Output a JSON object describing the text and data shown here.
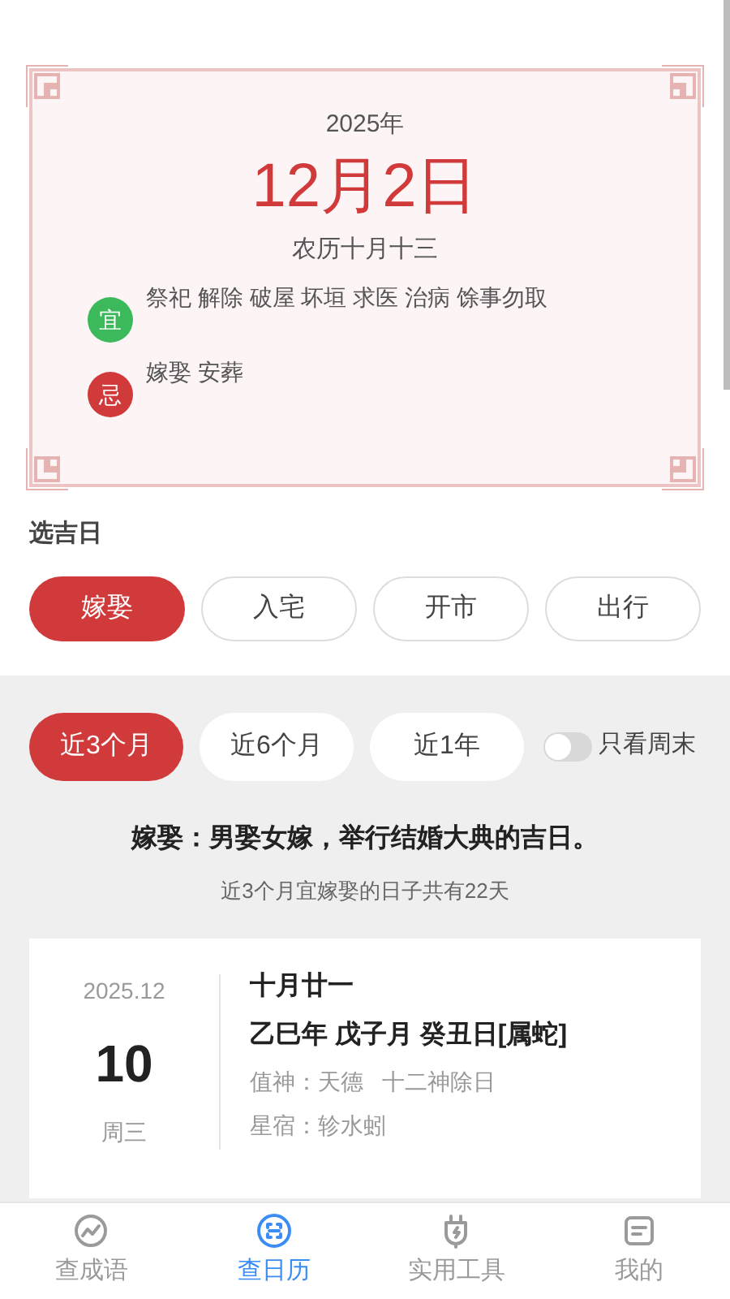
{
  "today": {
    "year": "2025年",
    "date": "12月2日",
    "lunar": "农历十月十三",
    "omens": [
      {
        "kind": "good",
        "badge": "宜",
        "text": "祭祀 解除 破屋 坏垣 求医 治病 馀事勿取"
      },
      {
        "kind": "bad",
        "badge": "忌",
        "text": "嫁娶 安葬"
      }
    ]
  },
  "section_title": "选吉日",
  "categories": [
    {
      "label": "嫁娶",
      "selected": true
    },
    {
      "label": "入宅",
      "selected": false
    },
    {
      "label": "开市",
      "selected": false
    },
    {
      "label": "出行",
      "selected": false
    }
  ],
  "ranges": [
    {
      "label": "近3个月",
      "selected": true
    },
    {
      "label": "近6个月",
      "selected": false
    },
    {
      "label": "近1年",
      "selected": false
    }
  ],
  "weekend_toggle": {
    "label": "只看周末",
    "on": false
  },
  "description": "嫁娶：男娶女嫁，举行结婚大典的吉日。",
  "summary": "近3个月宜嫁娶的日子共有22天",
  "results": [
    {
      "month": "2025.12",
      "day": "10",
      "weekday": "周三",
      "lunar": "十月廿一",
      "ganzhi": "乙巳年 戊子月 癸丑日[属蛇]",
      "deity": "值神：天德   十二神除日",
      "mansion": "星宿：轸水蚓"
    }
  ],
  "tabs": [
    {
      "label": "查成语",
      "kind": "idioms",
      "selected": false
    },
    {
      "label": "查日历",
      "kind": "calendar",
      "selected": true
    },
    {
      "label": "实用工具",
      "kind": "tools",
      "selected": false
    },
    {
      "label": "我的",
      "kind": "profile",
      "selected": false
    }
  ]
}
